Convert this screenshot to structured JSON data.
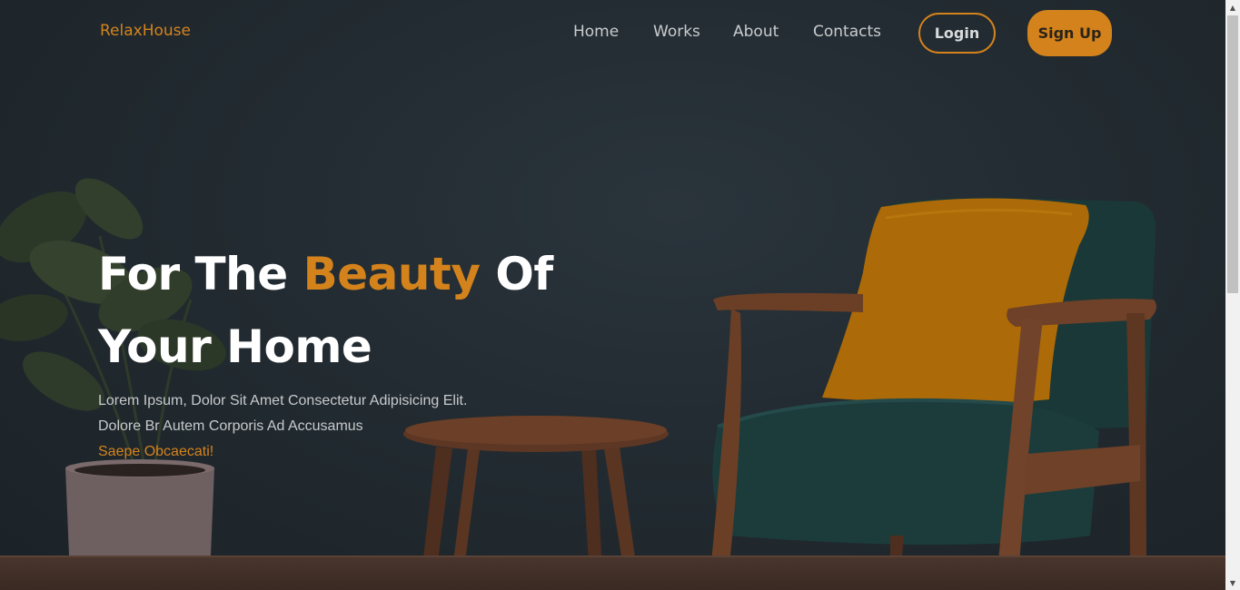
{
  "brand": {
    "logo": "RelaxHouse"
  },
  "nav": {
    "links": [
      "Home",
      "Works",
      "About",
      "Contacts"
    ],
    "login_label": "Login",
    "signup_label": "Sign Up"
  },
  "hero": {
    "headline_part1": "For The ",
    "headline_accent": "Beauty",
    "headline_part2": " Of",
    "headline_line2": "Your Home",
    "desc_line1": "Lorem Ipsum, Dolor Sit Amet Consectetur Adipisicing Elit.",
    "desc_line2": "Dolore Br Autem Corporis Ad Accusamus",
    "desc_accent": "Saepe Obcaecati!"
  },
  "colors": {
    "accent": "#d4831c",
    "background": "#222b31",
    "chair": "#1c3c3c",
    "pillow": "#b06d08",
    "wood": "#6b3f26"
  }
}
